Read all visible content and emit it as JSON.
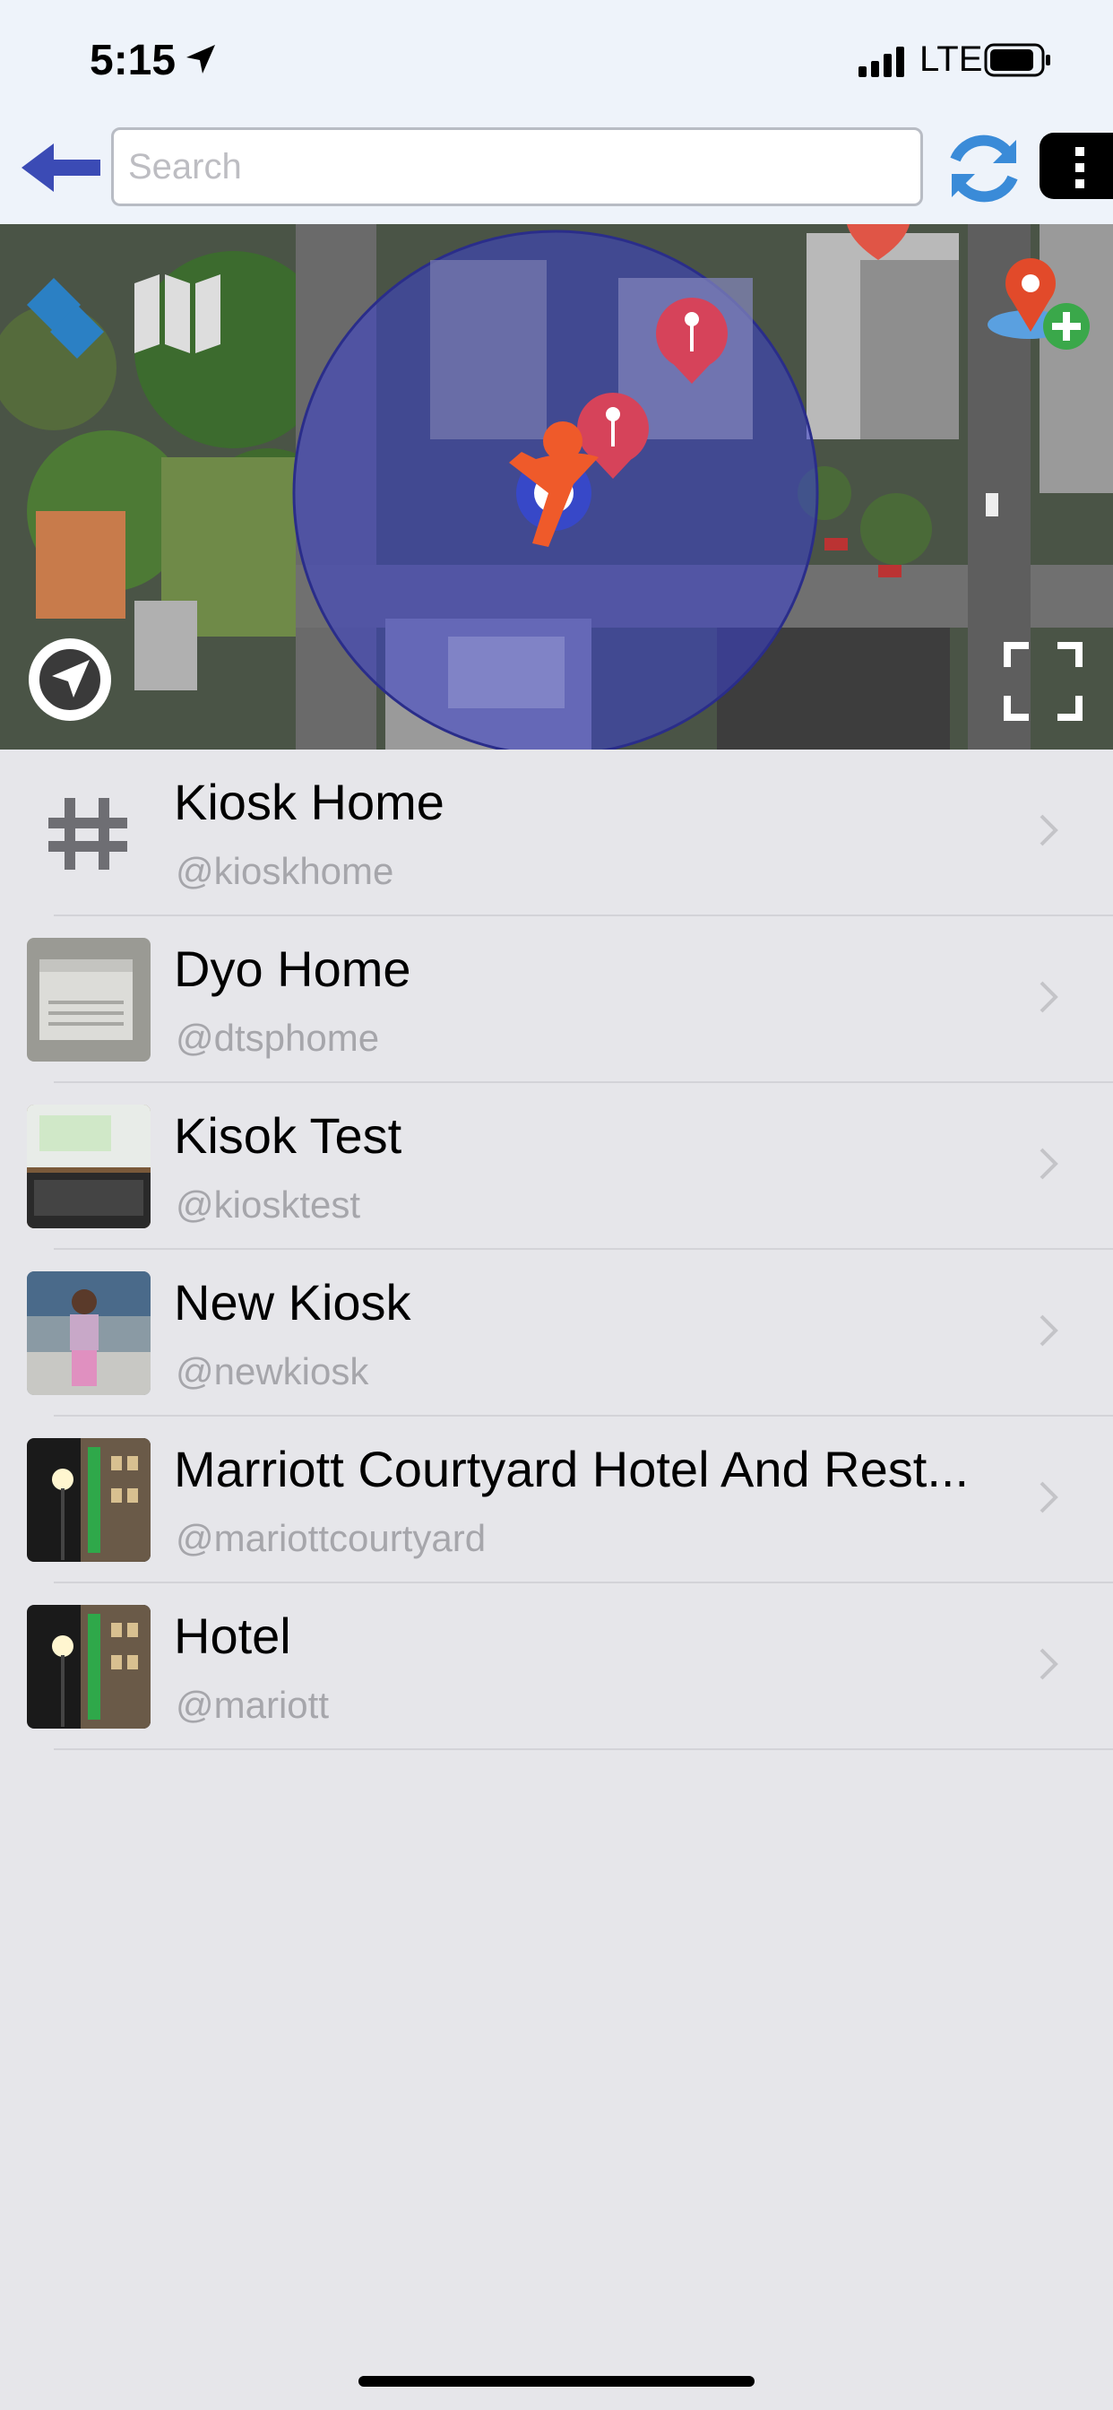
{
  "status_bar": {
    "time": "5:15",
    "network": "LTE"
  },
  "search": {
    "placeholder": "Search",
    "value": ""
  },
  "map": {
    "controls": [
      "layers-icon",
      "map-icon",
      "add-location-icon",
      "locate-icon",
      "fullscreen-icon"
    ]
  },
  "list": {
    "items": [
      {
        "title": "Kiosk Home",
        "handle": "@kioskhome",
        "thumb": "hashtag"
      },
      {
        "title": "Dyo Home",
        "handle": "@dtsphome",
        "thumb": "photo-appliance"
      },
      {
        "title": "Kisok Test",
        "handle": "@kiosktest",
        "thumb": "photo-laptop"
      },
      {
        "title": "New Kiosk",
        "handle": "@newkiosk",
        "thumb": "photo-child"
      },
      {
        "title": "Marriott Courtyard Hotel And Rest...",
        "handle": "@mariottcourtyard",
        "thumb": "photo-hotel-night"
      },
      {
        "title": "Hotel",
        "handle": "@mariott",
        "thumb": "photo-hotel-night"
      }
    ]
  },
  "colors": {
    "accent_blue": "#3b4bb5",
    "refresh_blue": "#3a8bd8",
    "pin_red": "#d6435a",
    "orange": "#ef5a2a"
  }
}
